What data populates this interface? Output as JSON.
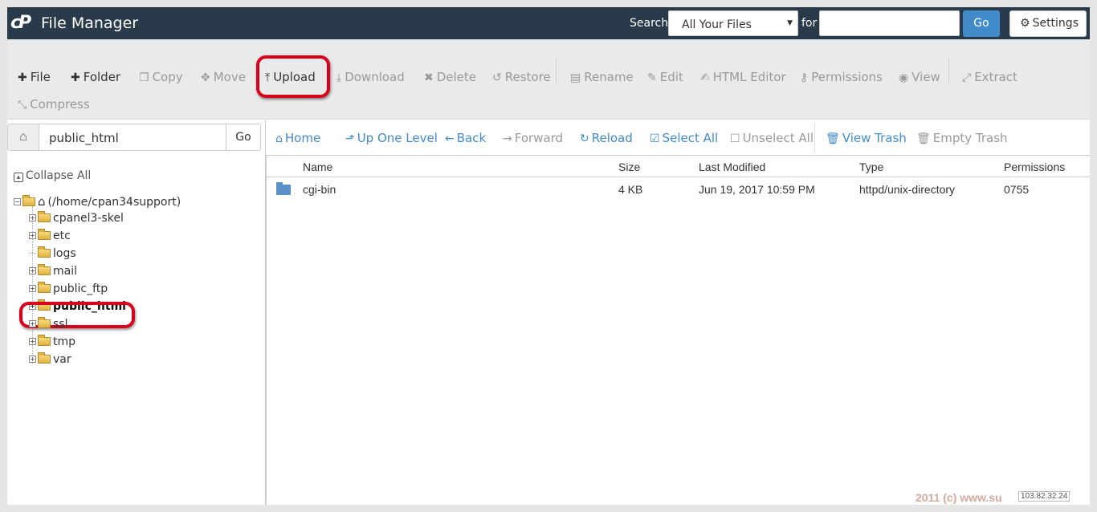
{
  "header": {
    "app_title": "File Manager",
    "search_label": "Search",
    "search_scope": "All Your Files",
    "for_label": "for",
    "search_value": "",
    "go_label": "Go",
    "settings_label": "Settings"
  },
  "toolbar": {
    "file": "File",
    "folder": "Folder",
    "copy": "Copy",
    "move": "Move",
    "upload": "Upload",
    "download": "Download",
    "delete": "Delete",
    "restore": "Restore",
    "rename": "Rename",
    "edit": "Edit",
    "html_editor": "HTML Editor",
    "permissions": "Permissions",
    "view": "View",
    "extract": "Extract",
    "compress": "Compress"
  },
  "left": {
    "path_value": "public_html",
    "go_label": "Go",
    "collapse_all": "Collapse All",
    "root": "(/home/cpan34support)",
    "tree": [
      "cpanel3-skel",
      "etc",
      "logs",
      "mail",
      "public_ftp",
      "public_html",
      "ssl",
      "tmp",
      "var"
    ]
  },
  "nav": {
    "home": "Home",
    "up_one_level": "Up One Level",
    "back": "Back",
    "forward": "Forward",
    "reload": "Reload",
    "select_all": "Select All",
    "unselect_all": "Unselect All",
    "view_trash": "View Trash",
    "empty_trash": "Empty Trash"
  },
  "table": {
    "columns": [
      "Name",
      "Size",
      "Last Modified",
      "Type",
      "Permissions"
    ],
    "rows": [
      {
        "name": "cgi-bin",
        "size": "4 KB",
        "modified": "Jun 19, 2017 10:59 PM",
        "type": "httpd/unix-directory",
        "perms": "0755"
      }
    ]
  },
  "footer": {
    "watermark": "2011 (c) www.su",
    "ip": "103.82.32.24"
  },
  "colors": {
    "header_bg": "#293a4a",
    "accent": "#428bca",
    "highlight": "#d9001b"
  }
}
